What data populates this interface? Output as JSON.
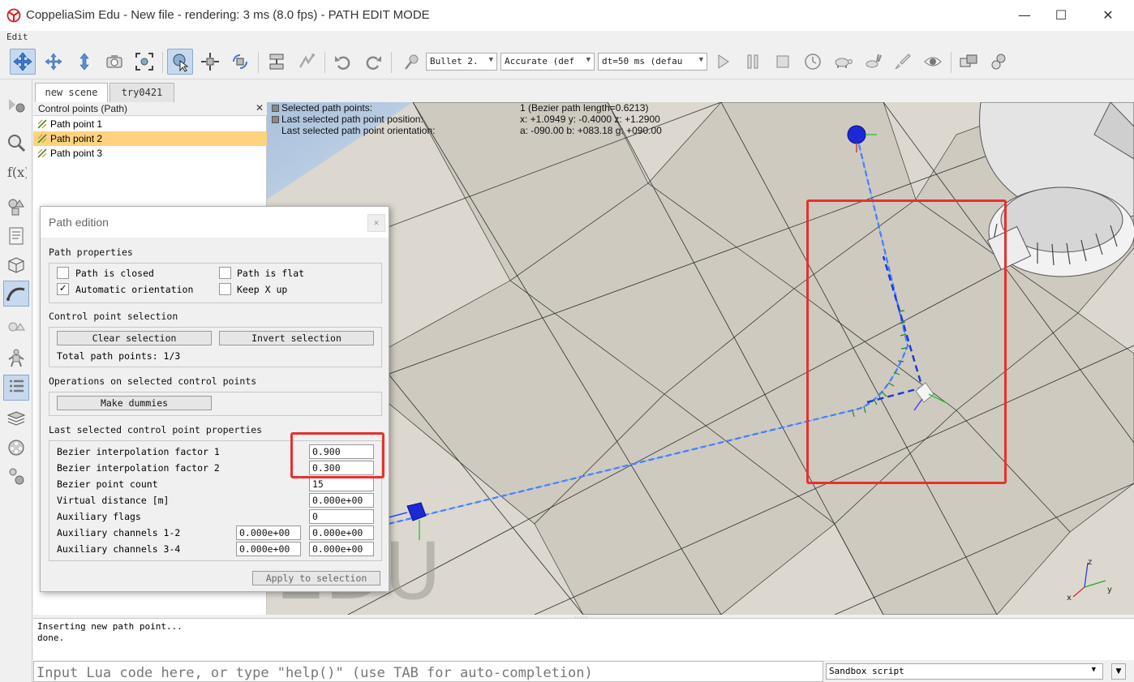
{
  "window": {
    "title": "CoppeliaSim Edu - New file - rendering: 3 ms (8.0 fps) - PATH EDIT MODE",
    "minimize": "—",
    "maximize": "☐",
    "close": "✕"
  },
  "menu": {
    "edit": "Edit"
  },
  "toolbar": {
    "engine": "Bullet 2.",
    "accuracy": "Accurate (def",
    "timestep": "dt=50 ms (defau"
  },
  "tabs": [
    {
      "label": "new scene"
    },
    {
      "label": "try0421"
    }
  ],
  "hierarchy": {
    "title": "Control points (Path)",
    "close": "✕",
    "items": [
      {
        "label": "Path point 1"
      },
      {
        "label": "Path point 2"
      },
      {
        "label": "Path point 3"
      }
    ]
  },
  "viewport": {
    "info": [
      {
        "label": "Selected path points:",
        "value": "1 (Bezier path length=0.6213)"
      },
      {
        "label": "Last selected path point position:",
        "value": "x: +1.0949    y: -0.4000    z: +1.2900"
      },
      {
        "label": "Last selected path point orientation:",
        "value": "a: -090.00    b: +083.18    g: +090.00"
      }
    ],
    "watermark": "EDU",
    "axis_labels": {
      "x": "x",
      "y": "y",
      "z": "z"
    },
    "colors": {
      "highlight": "#e8302c",
      "path": "#1e4fff"
    }
  },
  "dialog": {
    "title": "Path edition",
    "close": "✕",
    "path_properties": {
      "heading": "Path properties",
      "path_is_closed": {
        "label": "Path is closed",
        "checked": false
      },
      "path_is_flat": {
        "label": "Path is flat",
        "checked": false
      },
      "automatic_orientation": {
        "label": "Automatic orientation",
        "checked": true
      },
      "keep_x_up": {
        "label": "Keep X up",
        "checked": false
      }
    },
    "control_point_selection": {
      "heading": "Control point selection",
      "clear_selection": "Clear selection",
      "invert_selection": "Invert selection",
      "total_path_points": "Total path points: 1/3"
    },
    "operations": {
      "heading": "Operations on selected control points",
      "make_dummies": "Make dummies"
    },
    "last_selected": {
      "heading": "Last selected control point properties",
      "bezier_factor_1": {
        "label": "Bezier interpolation factor 1",
        "value": "0.900"
      },
      "bezier_factor_2": {
        "label": "Bezier interpolation factor 2",
        "value": "0.300"
      },
      "bezier_point_count": {
        "label": "Bezier point count",
        "value": "15"
      },
      "virtual_distance": {
        "label": "Virtual distance [m]",
        "value": "0.000e+00"
      },
      "auxiliary_flags": {
        "label": "Auxiliary flags",
        "value": "0"
      },
      "aux_channels_12": {
        "label": "Auxiliary channels 1-2",
        "value1": "0.000e+00",
        "value2": "0.000e+00"
      },
      "aux_channels_34": {
        "label": "Auxiliary channels 3-4",
        "value1": "0.000e+00",
        "value2": "0.000e+00"
      }
    },
    "apply_to_selection": "Apply to selection"
  },
  "console": {
    "lines": [
      "Inserting new path point...",
      "done."
    ]
  },
  "lua": {
    "placeholder": "Input Lua code here, or type \"help()\" (use TAB for auto-completion)",
    "script": "Sandbox script"
  }
}
